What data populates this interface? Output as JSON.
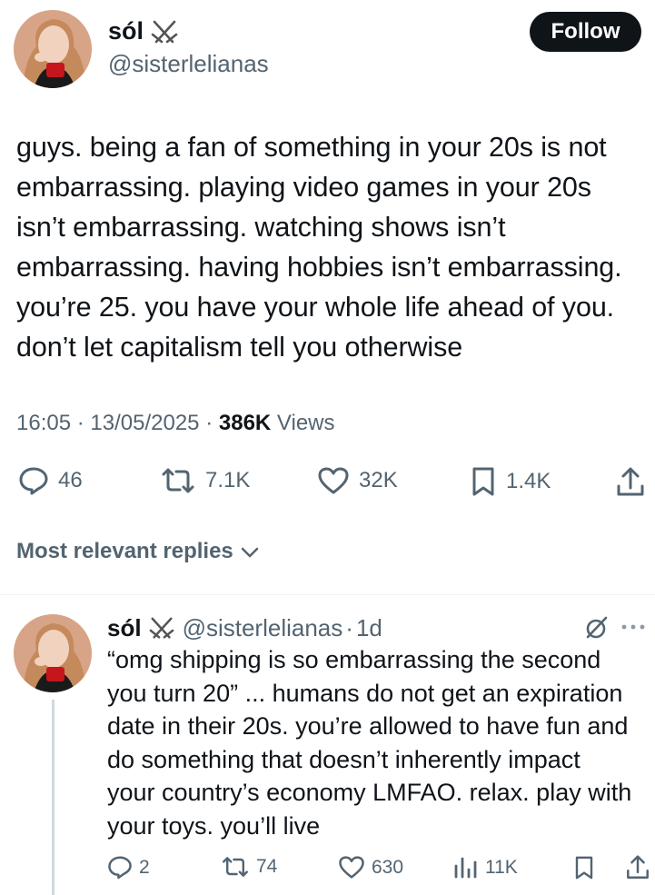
{
  "tweet": {
    "author_name": "sól",
    "author_badge": "crossed-swords",
    "author_handle": "@sisterlelianas",
    "follow_label": "Follow",
    "text": "guys. being a fan of something in your 20s is not\nembarrassing. playing video games in your 20s\nisn’t embarrassing. watching shows isn’t\nembarrassing. having hobbies isn’t embarrassing.\nyou’re 25. you have your whole life ahead of you.\ndon’t let capitalism tell you otherwise",
    "time": "16:05",
    "date": "13/05/2025",
    "views_count": "386K",
    "views_label": "Views",
    "replies": "46",
    "reposts": "7.1K",
    "likes": "32K",
    "bookmarks": "1.4K"
  },
  "replies_section": {
    "sort_label": "Most relevant replies"
  },
  "reply": {
    "author_name": "sól",
    "author_handle": "@sisterlelianas",
    "separator": "·",
    "age": "1d",
    "text": "“omg shipping is so embarrassing the second\nyou turn 20” ... humans do not get an expiration\ndate in their 20s. you’re allowed to have fun and\ndo something that doesn’t inherently impact\nyour country’s economy LMFAO. relax. play with\nyour toys. you’ll live",
    "replies": "2",
    "reposts": "74",
    "likes": "630",
    "views": "11K"
  },
  "colors": {
    "text": "#0f1419",
    "secondary": "#536471",
    "divider": "#eff3f4",
    "thread_line": "#cfd9de",
    "follow_bg": "#0f1419"
  }
}
